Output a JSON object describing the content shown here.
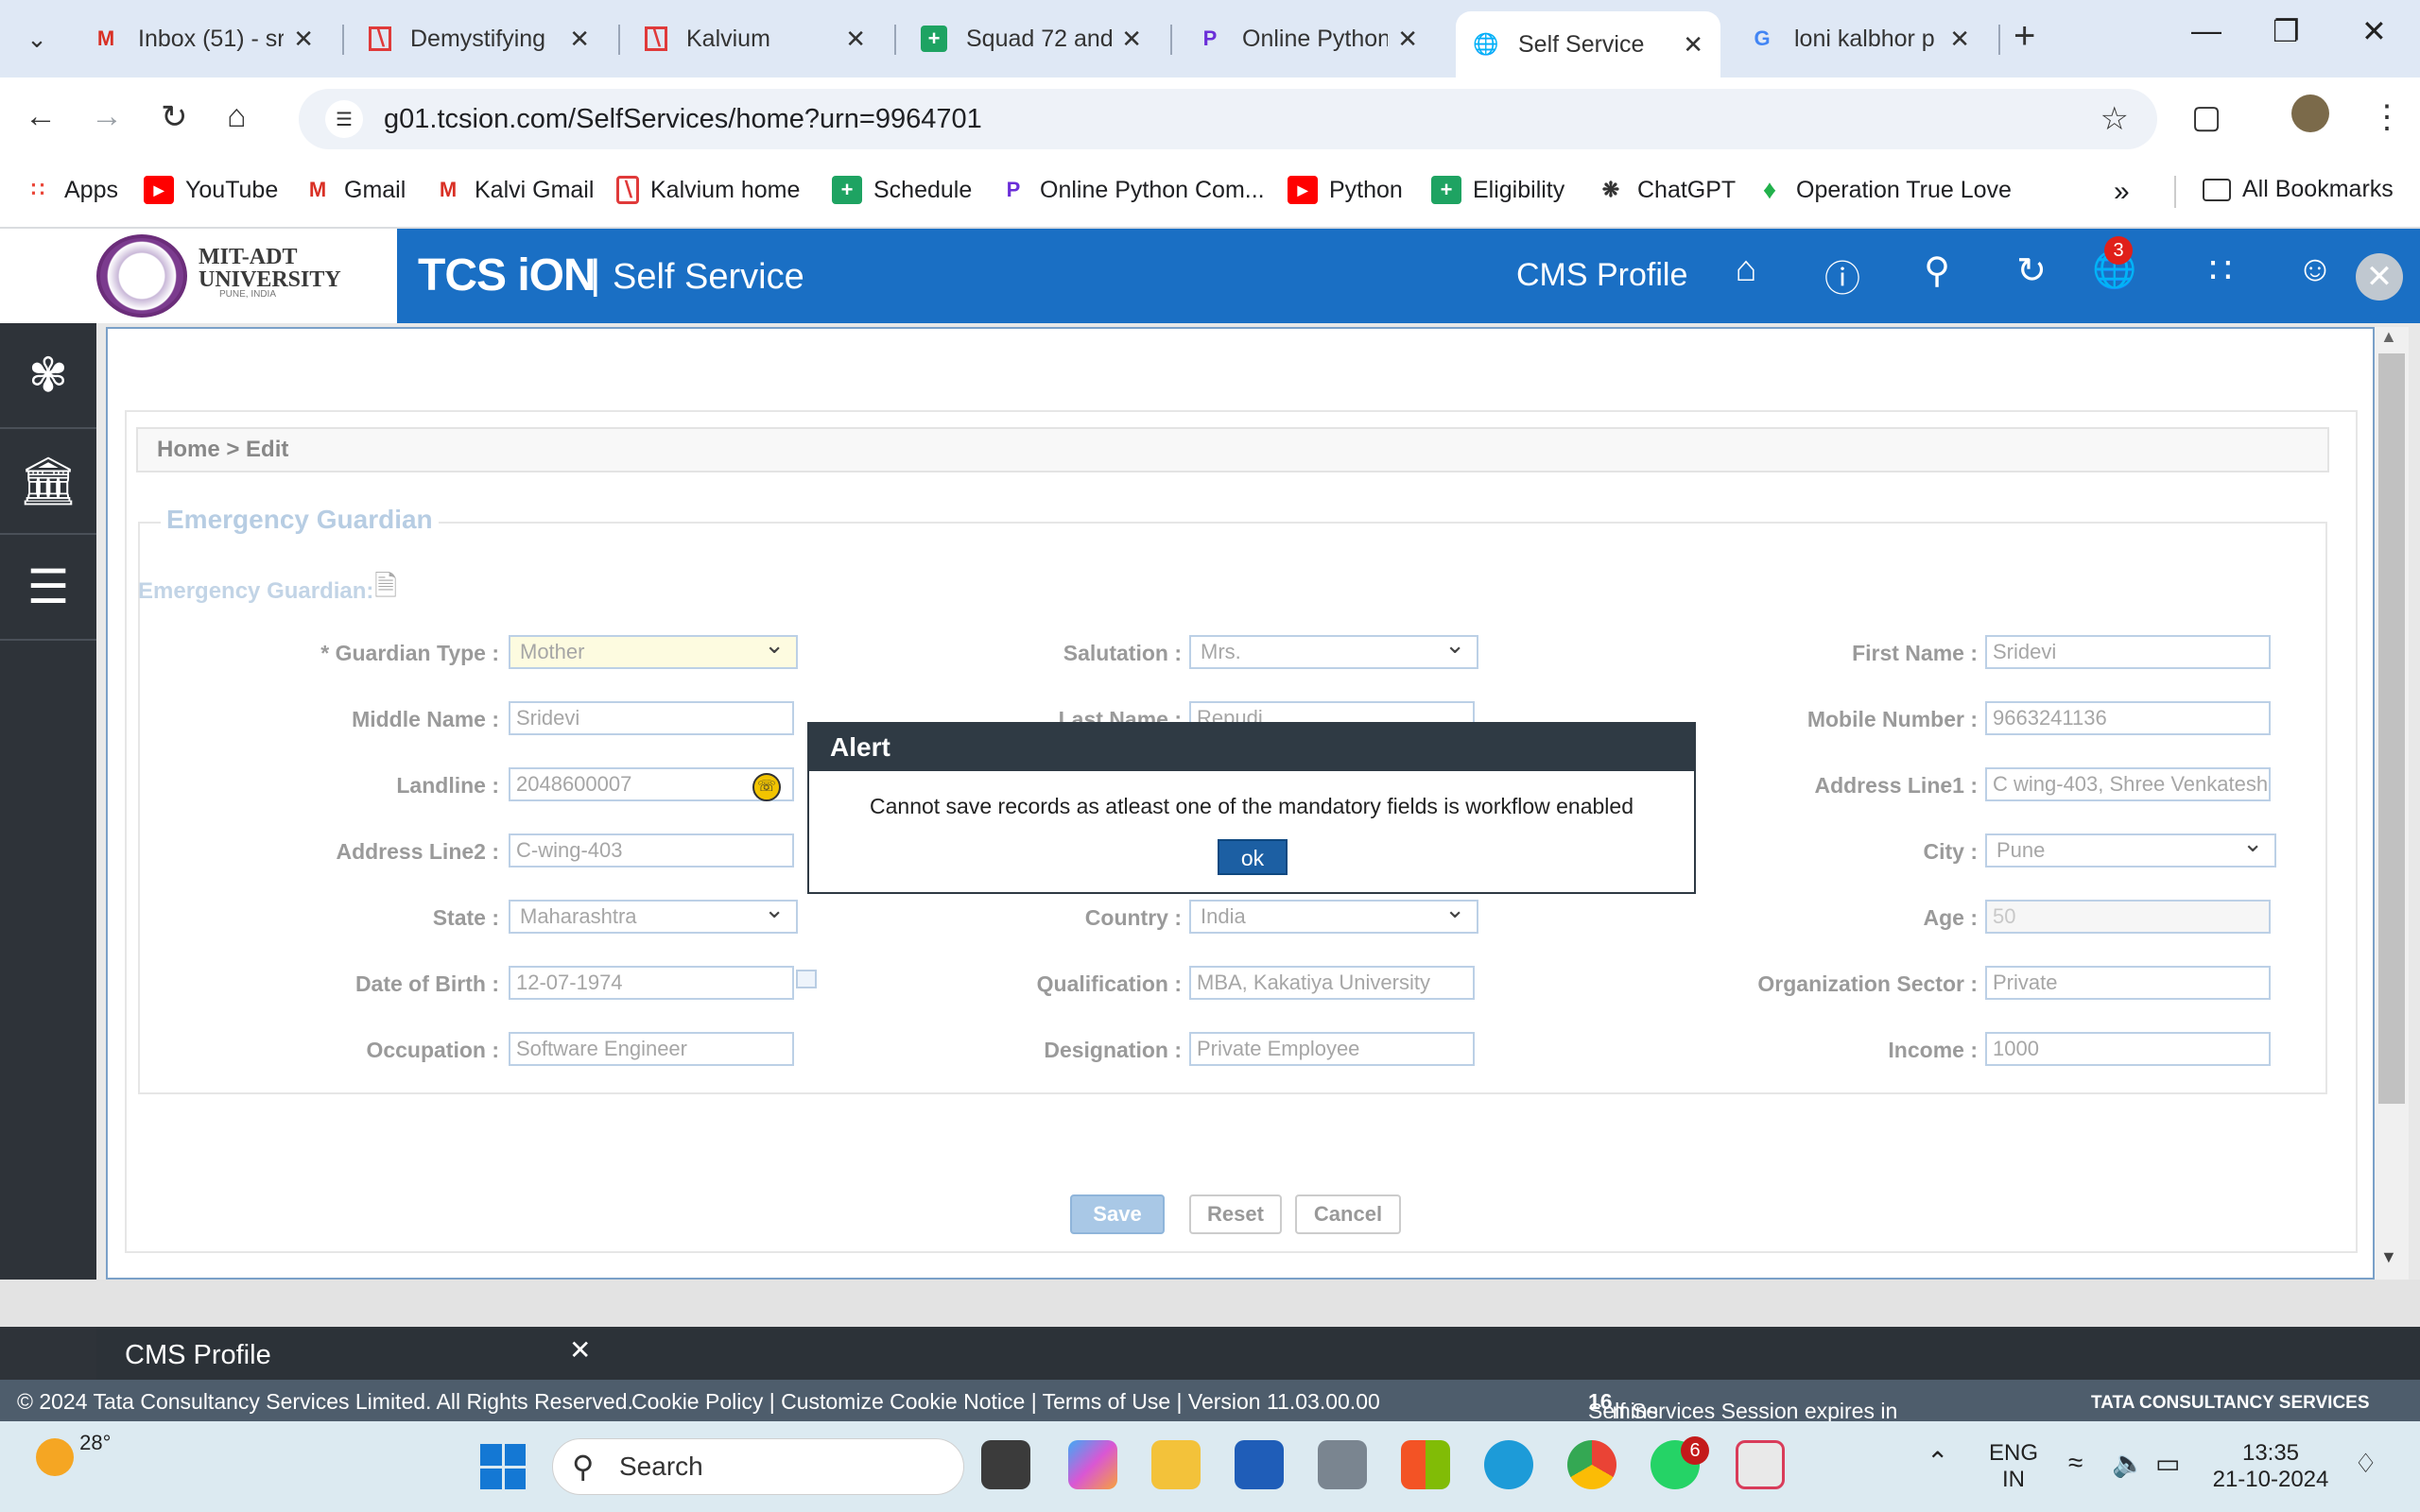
{
  "browser": {
    "tabs": [
      {
        "title": "Inbox (51) - sr",
        "icon": "gmail-icon"
      },
      {
        "title": "Demystifying",
        "icon": "kalvium-icon"
      },
      {
        "title": "Kalvium",
        "icon": "kalvium-icon"
      },
      {
        "title": "Squad 72 and",
        "icon": "sheets-icon"
      },
      {
        "title": "Online Python",
        "icon": "python-online-icon"
      },
      {
        "title": "Self Service",
        "icon": "globe-icon",
        "active": true
      },
      {
        "title": "loni kalbhor p",
        "icon": "google-icon"
      }
    ],
    "url": "g01.tcsion.com/SelfServices/home?urn=9964701",
    "bookmarks": [
      "Apps",
      "YouTube",
      "Gmail",
      "Kalvi Gmail",
      "Kalvium home",
      "Schedule",
      "Online Python Com...",
      "Python",
      "Eligibility",
      "ChatGPT",
      "Operation True Love"
    ],
    "all_bookmarks": "All Bookmarks"
  },
  "header": {
    "logo_name": "MIT-ADT\nUNIVERSITY",
    "logo_sub": "PUNE, INDIA",
    "brand": "TCS iON",
    "product": "Self Service",
    "profile": "CMS Profile",
    "notification_count": "3",
    "brand_color": "#1a6fc4"
  },
  "breadcrumb": "Home > Edit",
  "section": {
    "legend": "Emergency Guardian",
    "subheading": "Emergency Guardian:"
  },
  "form": {
    "guardian_type": {
      "label": "* Guardian Type :",
      "value": "Mother"
    },
    "salutation": {
      "label": "Salutation :",
      "value": "Mrs."
    },
    "first_name": {
      "label": "First Name :",
      "value": "Sridevi"
    },
    "middle_name": {
      "label": "Middle Name :",
      "value": "Sridevi"
    },
    "last_name": {
      "label": "Last Name :",
      "value": "Repudi"
    },
    "mobile": {
      "label": "Mobile Number :",
      "value": "9663241136"
    },
    "landline": {
      "label": "Landline :",
      "value": "2048600007"
    },
    "address1": {
      "label": "Address Line1 :",
      "value": "C wing-403, Shree Venkatesh"
    },
    "address2": {
      "label": "Address Line2 :",
      "value": "C-wing-403"
    },
    "city": {
      "label": "City :",
      "value": "Pune"
    },
    "state": {
      "label": "State :",
      "value": "Maharashtra"
    },
    "country": {
      "label": "Country :",
      "value": "India"
    },
    "age": {
      "label": "Age :",
      "value": "50"
    },
    "dob": {
      "label": "Date of Birth :",
      "value": "12-07-1974"
    },
    "qualification": {
      "label": "Qualification :",
      "value": "MBA, Kakatiya University"
    },
    "org_sector": {
      "label": "Organization Sector :",
      "value": "Private"
    },
    "occupation": {
      "label": "Occupation :",
      "value": "Software Engineer"
    },
    "designation": {
      "label": "Designation :",
      "value": "Private Employee"
    },
    "income": {
      "label": "Income :",
      "value": "1000"
    }
  },
  "buttons": {
    "save": "Save",
    "reset": "Reset",
    "cancel": "Cancel"
  },
  "alert": {
    "title": "Alert",
    "message": "Cannot save records as atleast one of the mandatory fields is workflow enabled",
    "ok": "ok"
  },
  "cms_bar": {
    "title": "CMS Profile"
  },
  "footer": {
    "copyright": "© 2024 Tata Consultancy Services Limited. All Rights Reserved.",
    "links": "Cookie Policy | Customize Cookie Notice | Terms of Use | Version 11.03.00.00",
    "session_prefix": "Self Services Session expires in ",
    "session_mins": "16",
    "session_suffix": " mins",
    "tcs": "TATA CONSULTANCY SERVICES"
  },
  "taskbar": {
    "temperature": "28°",
    "search": "Search",
    "whatsapp_badge": "6",
    "lang_top": "ENG",
    "lang_bottom": "IN",
    "time": "13:35",
    "date": "21-10-2024"
  }
}
